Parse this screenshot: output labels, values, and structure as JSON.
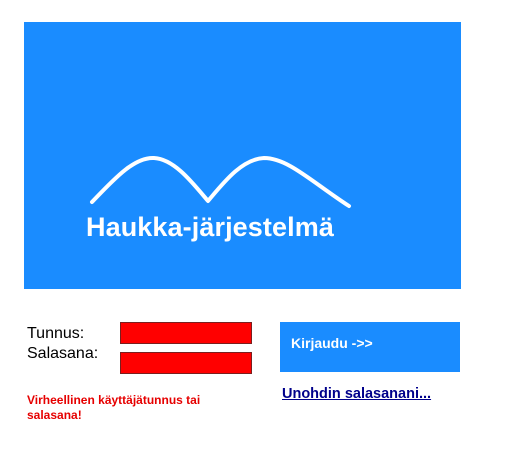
{
  "banner": {
    "title": "Haukka-järjestelmä",
    "logo_icon": "hawk-wings-icon",
    "background_color": "#1a8cff"
  },
  "login_form": {
    "username_label": "Tunnus:",
    "username_value": "",
    "password_label": "Salasana:",
    "password_value": "",
    "field_color": "#ff0000",
    "submit_label": "Kirjaudu ->>",
    "forgot_password_label": "Unohdin salasanani..."
  },
  "error": {
    "message": "Virheellinen käyttäjätunnus tai salasana!",
    "color": "#e60000"
  }
}
